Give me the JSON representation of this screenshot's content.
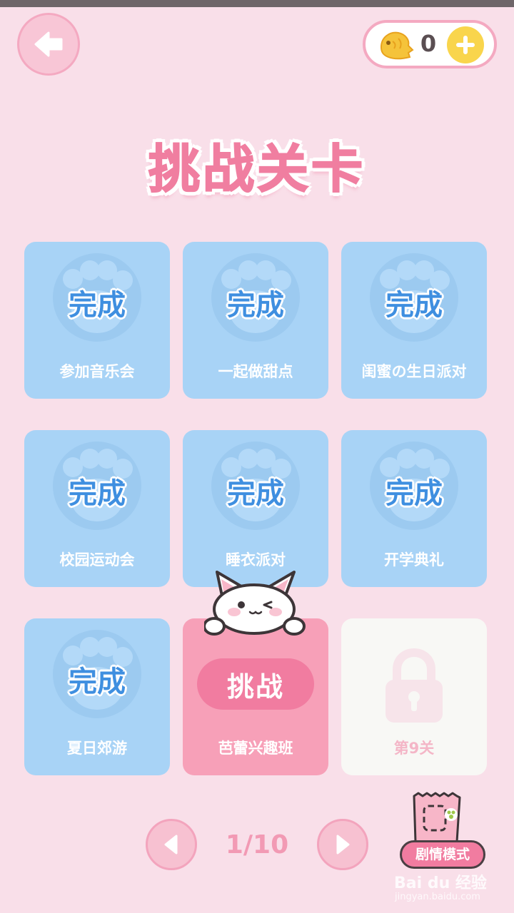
{
  "header": {
    "coin_count": "0",
    "title": "挑战关卡"
  },
  "levels": [
    {
      "name": "参加音乐会",
      "status": "done",
      "badge": "完成"
    },
    {
      "name": "一起做甜点",
      "status": "done",
      "badge": "完成"
    },
    {
      "name": "闺蜜の生日派对",
      "status": "done",
      "badge": "完成"
    },
    {
      "name": "校园运动会",
      "status": "done",
      "badge": "完成"
    },
    {
      "name": "睡衣派对",
      "status": "done",
      "badge": "完成"
    },
    {
      "name": "开学典礼",
      "status": "done",
      "badge": "完成"
    },
    {
      "name": "夏日郊游",
      "status": "done",
      "badge": "完成"
    },
    {
      "name": "芭蕾兴趣班",
      "status": "challenge",
      "badge": "挑战"
    },
    {
      "name": "第9关",
      "status": "locked",
      "badge": ""
    }
  ],
  "pager": {
    "indicator": "1/10"
  },
  "story_mode": {
    "label": "剧情模式"
  },
  "watermark": {
    "brand": "Bai du 经验",
    "url": "jingyan.baidu.com"
  },
  "colors": {
    "background": "#f9dfe9",
    "done_card": "#a8d3f6",
    "challenge_card": "#f7a0b8",
    "locked_card": "#f8f8f5",
    "accent_pink": "#f17ca0",
    "coin_yellow": "#f9d54c"
  },
  "icons": {
    "back": "arrow-left-icon",
    "coin": "taiyaki-fish-icon",
    "add": "plus-icon",
    "paw": "paw-print-icon",
    "lock": "lock-icon",
    "prev": "triangle-left-icon",
    "next": "triangle-right-icon",
    "cat": "winking-cat-mascot-icon",
    "story": "stamp-card-icon"
  }
}
